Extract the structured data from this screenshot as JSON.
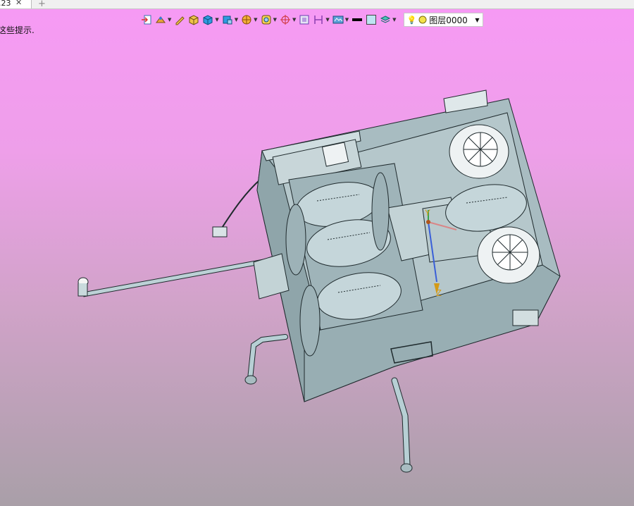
{
  "tab": {
    "title": ".23",
    "close_glyph": "✕",
    "new_glyph": "+"
  },
  "hint": {
    "text": "这些提示."
  },
  "toolbar": {
    "icons": [
      "exit-icon",
      "snap-icon",
      "pen-icon",
      "box-render-icon",
      "solid-cube-icon",
      "shade-icon",
      "section-icon",
      "filter-icon",
      "orientation-icon",
      "frame-icon",
      "dimension-icon",
      "view-icon",
      "line-color-swatch",
      "fill-color-swatch",
      "layers-icon"
    ],
    "layer": {
      "bulb": "💡",
      "value": "图层0000"
    }
  },
  "axes": {
    "x": "X",
    "y": "Y",
    "z": "Z"
  },
  "colors": {
    "model_fill": "#a8bcc1",
    "model_edge": "#1f2a2d",
    "axis_z": "#d49a17",
    "axis_y": "#d49a17"
  }
}
